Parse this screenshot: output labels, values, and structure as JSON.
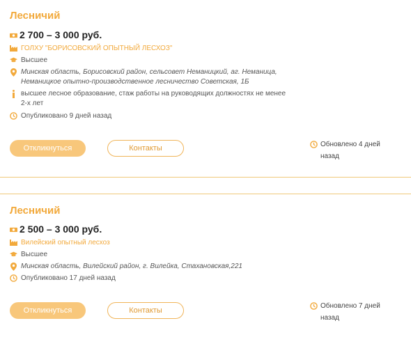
{
  "vacancies": [
    {
      "title": "Лесничий",
      "salary": "2 700 – 3 000 руб.",
      "company": "ГОЛХУ \"БОРИСОВСКИЙ ОПЫТНЫЙ ЛЕСХОЗ\"",
      "education": "Высшее",
      "address": "Минская область, Борисовский район, сельсовет Неманицкий, аг. Неманица, Неманицкое опытно-производственное лесничество Советская, 1Б",
      "requirements": "высшее лесное образование, стаж работы на руководящих должностях не менее 2-х лет",
      "published": "Опубликовано 9 дней назад",
      "respond_label": "Откликнуться",
      "contacts_label": "Контакты",
      "updated": "Обновлено 4 дней назад"
    },
    {
      "title": "Лесничий",
      "salary": "2 500 – 3 000 руб.",
      "company": "Вилейский опытный лесхоз",
      "education": "Высшее",
      "address": "Минская область, Вилейский район, г. Вилейка, Стахановская,221",
      "published": "Опубликовано 17 дней назад",
      "respond_label": "Откликнуться",
      "contacts_label": "Контакты",
      "updated": "Обновлено 7 дней назад"
    }
  ],
  "colors": {
    "accent": "#f2a93b",
    "button_fill": "#f8c77b",
    "divider": "#f0c97a"
  },
  "icons": [
    "money-icon",
    "factory-icon",
    "graduation-cap-icon",
    "location-pin-icon",
    "info-icon",
    "clock-icon"
  ]
}
